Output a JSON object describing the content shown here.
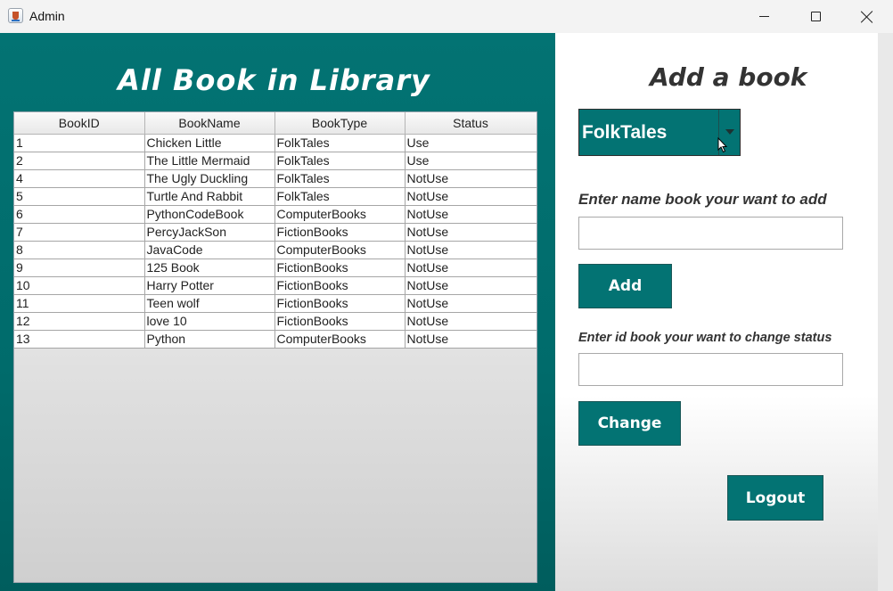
{
  "window": {
    "title": "Admin"
  },
  "library": {
    "title": "All Book in Library",
    "columns": [
      "BookID",
      "BookName",
      "BookType",
      "Status"
    ],
    "rows": [
      [
        "1",
        "Chicken Little",
        "FolkTales",
        "Use"
      ],
      [
        "2",
        "The Little Mermaid",
        "FolkTales",
        "Use"
      ],
      [
        "4",
        "The Ugly Duckling",
        "FolkTales",
        "NotUse"
      ],
      [
        "5",
        "Turtle And Rabbit",
        "FolkTales",
        "NotUse"
      ],
      [
        "6",
        "PythonCodeBook",
        "ComputerBooks",
        "NotUse"
      ],
      [
        "7",
        "PercyJackSon",
        "FictionBooks",
        "NotUse"
      ],
      [
        "8",
        "JavaCode",
        "ComputerBooks",
        "NotUse"
      ],
      [
        "9",
        "125 Book",
        "FictionBooks",
        "NotUse"
      ],
      [
        "10",
        "Harry Potter",
        "FictionBooks",
        "NotUse"
      ],
      [
        "11",
        "Teen wolf",
        "FictionBooks",
        "NotUse"
      ],
      [
        "12",
        "love 10",
        "FictionBooks",
        "NotUse"
      ],
      [
        "13",
        "Python",
        "ComputerBooks",
        "NotUse"
      ]
    ]
  },
  "add_book": {
    "title": "Add a book",
    "type_select": {
      "selected": "FolkTales"
    },
    "name_label": "Enter name book  your want to add",
    "name_value": "",
    "add_button": "Add",
    "id_label": "Enter id book  your want to change status",
    "id_value": "",
    "change_button": "Change",
    "logout_button": "Logout"
  },
  "colors": {
    "accent": "#037373",
    "panel_text": "#333333"
  },
  "icons": {
    "app": "java-cup-icon",
    "dropdown": "caret-down-icon",
    "cursor": "mouse-pointer-icon"
  }
}
